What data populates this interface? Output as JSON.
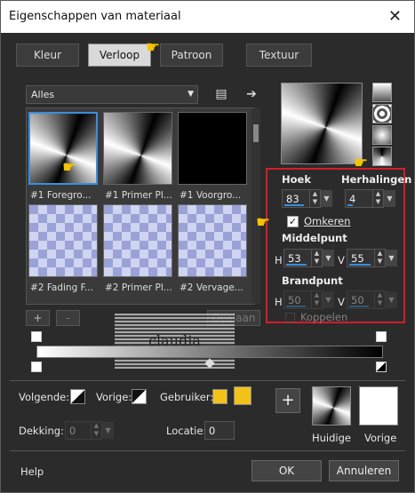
{
  "window": {
    "title": "Eigenschappen van materiaal"
  },
  "tabs": [
    {
      "label": "Kleur",
      "active": false
    },
    {
      "label": "Verloop",
      "active": true
    },
    {
      "label": "Patroon",
      "active": false
    },
    {
      "label": "Textuur",
      "active": false
    }
  ],
  "category": {
    "value": "Alles"
  },
  "gallery": [
    {
      "label": "#1 Foregro...",
      "kind": "gradient",
      "selected": true
    },
    {
      "label": "#1 Primer Pl...",
      "kind": "gradient",
      "selected": false
    },
    {
      "label": "#1 Voorgro...",
      "kind": "black",
      "selected": false
    },
    {
      "label": "#2 Fading F...",
      "kind": "checker",
      "selected": false
    },
    {
      "label": "#2 Primer Pl...",
      "kind": "checker",
      "selected": false
    },
    {
      "label": "#2 Vervage...",
      "kind": "checker",
      "selected": false
    }
  ],
  "gallery_buttons": {
    "add": "+",
    "remove": "-",
    "save": "Opslaan"
  },
  "properties": {
    "angle_label": "Hoek",
    "angle_value": "83",
    "repeats_label": "Herhalingen",
    "repeats_value": "4",
    "invert_label": "Omkeren",
    "invert_checked": true,
    "center_label": "Middelpunt",
    "center_h_label": "H",
    "center_h": "53",
    "center_v_label": "V",
    "center_v": "55",
    "focal_label": "Brandpunt",
    "focal_h_label": "H",
    "focal_h": "50",
    "focal_v_label": "V",
    "focal_v": "50",
    "link_label": "Koppelen"
  },
  "watermark": {
    "text": "claudia"
  },
  "stops": {
    "next_label": "Volgende:",
    "prev_label": "Vorige:",
    "user_label": "Gebruiker:",
    "opacity_label": "Dekking:",
    "opacity_value": "0",
    "location_label": "Locatie:",
    "location_value": "0"
  },
  "swatches": {
    "current_label": "Huidige",
    "previous_label": "Vorige"
  },
  "footer": {
    "help": "Help",
    "ok": "OK",
    "cancel": "Annuleren"
  },
  "colors": {
    "accent": "#3a8dde",
    "highlight": "#d0202a",
    "user_swatch": "#f2c21a"
  }
}
